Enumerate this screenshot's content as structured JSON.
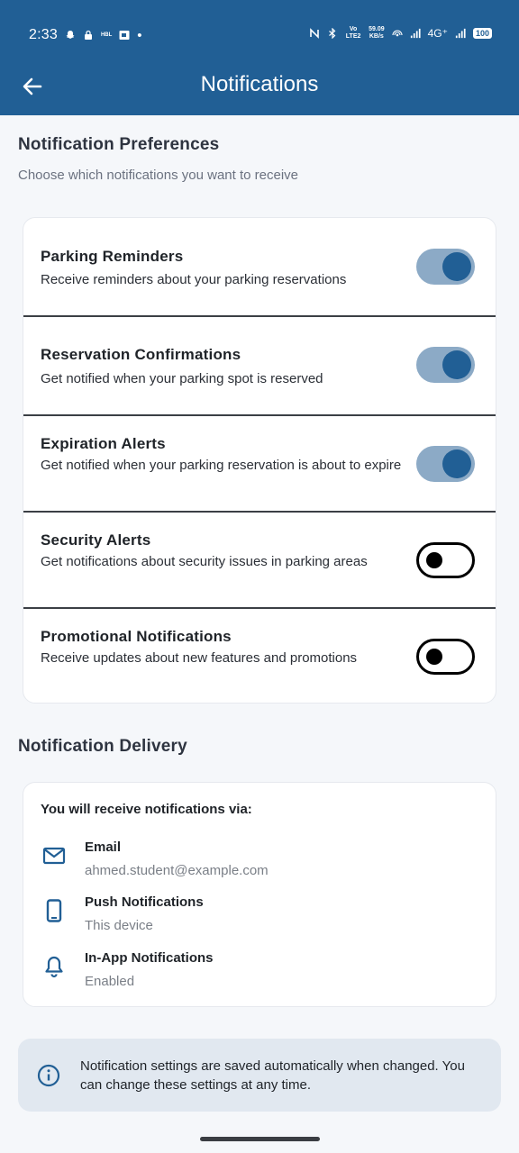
{
  "status_bar": {
    "time": "2:33",
    "hbl": "HBL",
    "dot": "•",
    "speed_value": "59.09",
    "speed_unit": "KB/s",
    "volte": "Vo LTE2",
    "network": "4G⁺",
    "battery": "100"
  },
  "app_bar": {
    "title": "Notifications"
  },
  "preferences": {
    "title": "Notification Preferences",
    "subtitle": "Choose which notifications you want to receive",
    "items": [
      {
        "title": "Parking Reminders",
        "description": "Receive reminders about your parking reservations",
        "enabled": true
      },
      {
        "title": "Reservation Confirmations",
        "description": "Get notified when your parking spot is reserved",
        "enabled": true
      },
      {
        "title": "Expiration Alerts",
        "description": "Get notified when your parking reservation is about to expire",
        "enabled": true
      },
      {
        "title": "Security Alerts",
        "description": "Get notifications about security issues in parking areas",
        "enabled": false
      },
      {
        "title": "Promotional Notifications",
        "description": "Receive updates about new features and promotions",
        "enabled": false
      }
    ]
  },
  "delivery": {
    "title": "Notification Delivery",
    "heading": "You will receive notifications via:",
    "channels": [
      {
        "icon": "mail-icon",
        "label": "Email",
        "value": "ahmed.student@example.com"
      },
      {
        "icon": "phone-icon",
        "label": "Push Notifications",
        "value": "This device"
      },
      {
        "icon": "bell-icon",
        "label": "In-App Notifications",
        "value": "Enabled"
      }
    ]
  },
  "info": {
    "icon": "info-icon",
    "text": "Notification settings are saved automatically when changed. You can change these settings at any time."
  },
  "colors": {
    "primary": "#215f95",
    "toggle_track_on": "#8caac6",
    "background": "#f5f7fa",
    "info_bg": "#e1e8f0"
  }
}
